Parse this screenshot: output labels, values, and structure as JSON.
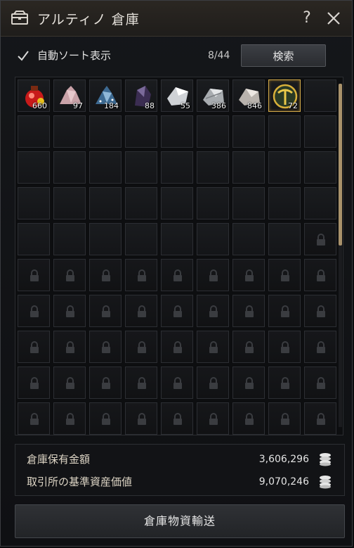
{
  "window": {
    "title": "アルティノ 倉庫",
    "help_label": "?"
  },
  "controls": {
    "auto_sort_label": "自動ソート表示",
    "auto_sort_checked": true,
    "slot_count": "8/44",
    "search_label": "検索"
  },
  "items": [
    {
      "name": "red-potion-icon",
      "qty": "660"
    },
    {
      "name": "pink-ore-icon",
      "qty": "97"
    },
    {
      "name": "blue-ore-icon",
      "qty": "184"
    },
    {
      "name": "dark-purple-stone-icon",
      "qty": "88"
    },
    {
      "name": "silver-ore-icon",
      "qty": "55"
    },
    {
      "name": "gray-ore-icon",
      "qty": "386"
    },
    {
      "name": "pale-ore-icon",
      "qty": "846"
    },
    {
      "name": "gold-pickaxe-icon",
      "qty": "72"
    }
  ],
  "money": {
    "warehouse_label": "倉庫保有金額",
    "warehouse_value": "3,606,296",
    "market_label": "取引所の基準資産価値",
    "market_value": "9,070,246"
  },
  "transport_label": "倉庫物資輸送",
  "colors": {
    "selected_border": "#d2a94a",
    "scroll_thumb": "#a9926b"
  }
}
